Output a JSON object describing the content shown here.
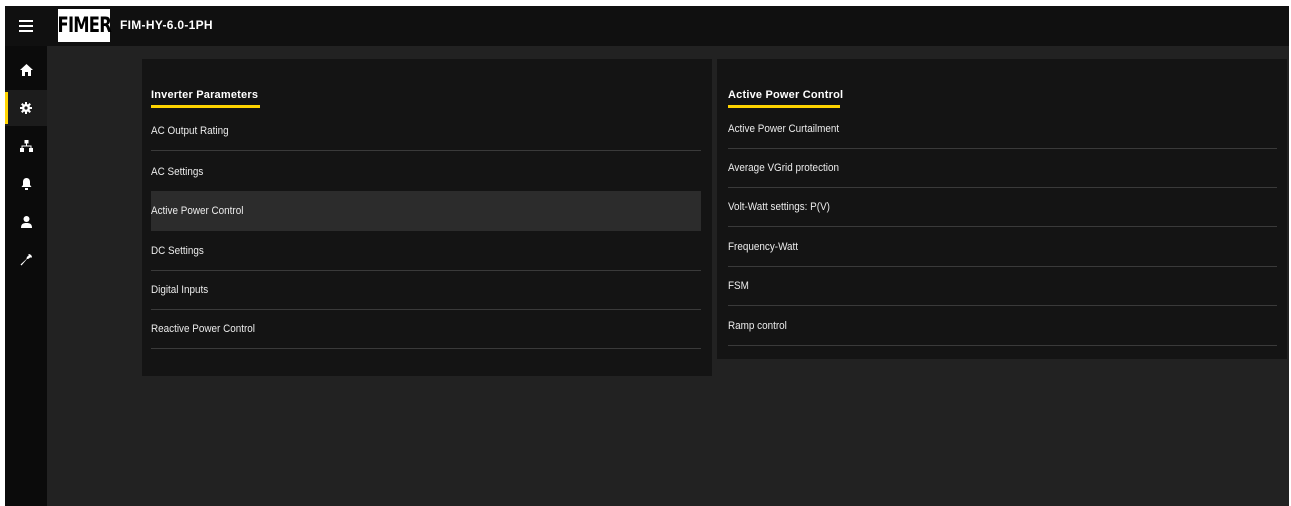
{
  "header": {
    "logo_text": "FIMER",
    "device_name": "FIM-HY-6.0-1PH",
    "menu_icon": "hamburger-menu-icon"
  },
  "sidebar": {
    "items": [
      {
        "icon": "home-icon",
        "active": false
      },
      {
        "icon": "gear-icon",
        "active": true
      },
      {
        "icon": "network-icon",
        "active": false
      },
      {
        "icon": "bell-icon",
        "active": false
      },
      {
        "icon": "user-icon",
        "active": false
      },
      {
        "icon": "wrench-icon",
        "active": false
      }
    ]
  },
  "inverter_parameters": {
    "title": "Inverter Parameters",
    "items": [
      {
        "label": "AC Output Rating",
        "selected": false
      },
      {
        "label": "AC Settings",
        "selected": false
      },
      {
        "label": "Active Power Control",
        "selected": true
      },
      {
        "label": "DC Settings",
        "selected": false
      },
      {
        "label": "Digital Inputs",
        "selected": false
      },
      {
        "label": "Reactive Power Control",
        "selected": false
      }
    ]
  },
  "active_power_control": {
    "title": "Active Power Control",
    "items": [
      {
        "label": "Active Power Curtailment"
      },
      {
        "label": "Average VGrid protection"
      },
      {
        "label": "Volt-Watt settings: P(V)"
      },
      {
        "label": "Frequency-Watt"
      },
      {
        "label": "FSM"
      },
      {
        "label": "Ramp control"
      }
    ]
  },
  "colors": {
    "accent": "#ffd400",
    "background": "#222222",
    "panel": "#141414",
    "topbar": "#101010"
  }
}
